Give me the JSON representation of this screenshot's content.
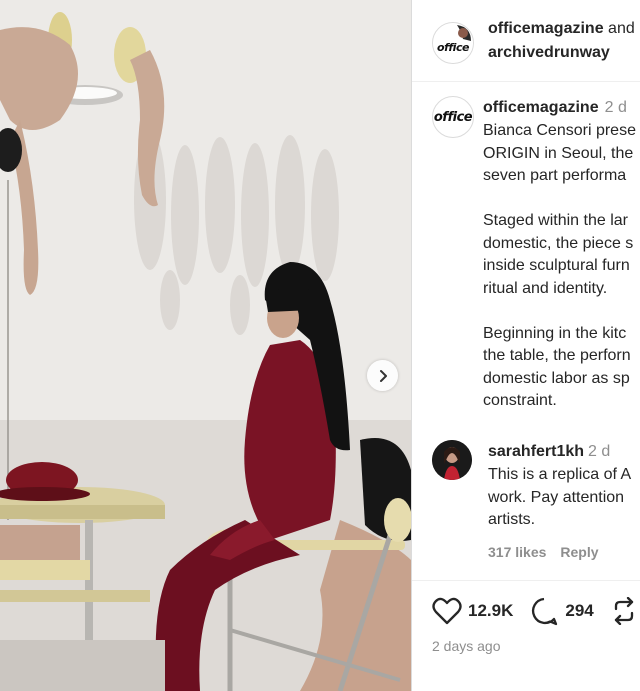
{
  "header": {
    "account": "officemagazine",
    "conjunction": "and",
    "collaborator": "archivedrunway",
    "logo_text": "office"
  },
  "caption": {
    "user": "officemagazine",
    "time": "2 d",
    "logo_text": "office",
    "lines": [
      "Bianca Censori prese",
      "ORIGIN in Seoul, the",
      "seven part performa",
      "",
      "Staged within the lar",
      "domestic, the piece s",
      "inside sculptural furn",
      "ritual and identity.",
      "",
      "Beginning in the kitc",
      "the table, the perforn",
      "domestic labor as sp",
      "constraint."
    ]
  },
  "comment": {
    "user": "sarahfert1kh",
    "time": "2 d",
    "lines": [
      "This is a replica of A",
      "work. Pay attention ",
      "artists."
    ],
    "likes": "317 likes",
    "reply": "Reply"
  },
  "actions": {
    "like_count": "12.9K",
    "comment_count": "294"
  },
  "posted": "2 days ago",
  "icons": {
    "next": "chevron-right-icon",
    "like": "heart-icon",
    "comment": "comment-bubble-icon",
    "repost": "repost-icon"
  }
}
